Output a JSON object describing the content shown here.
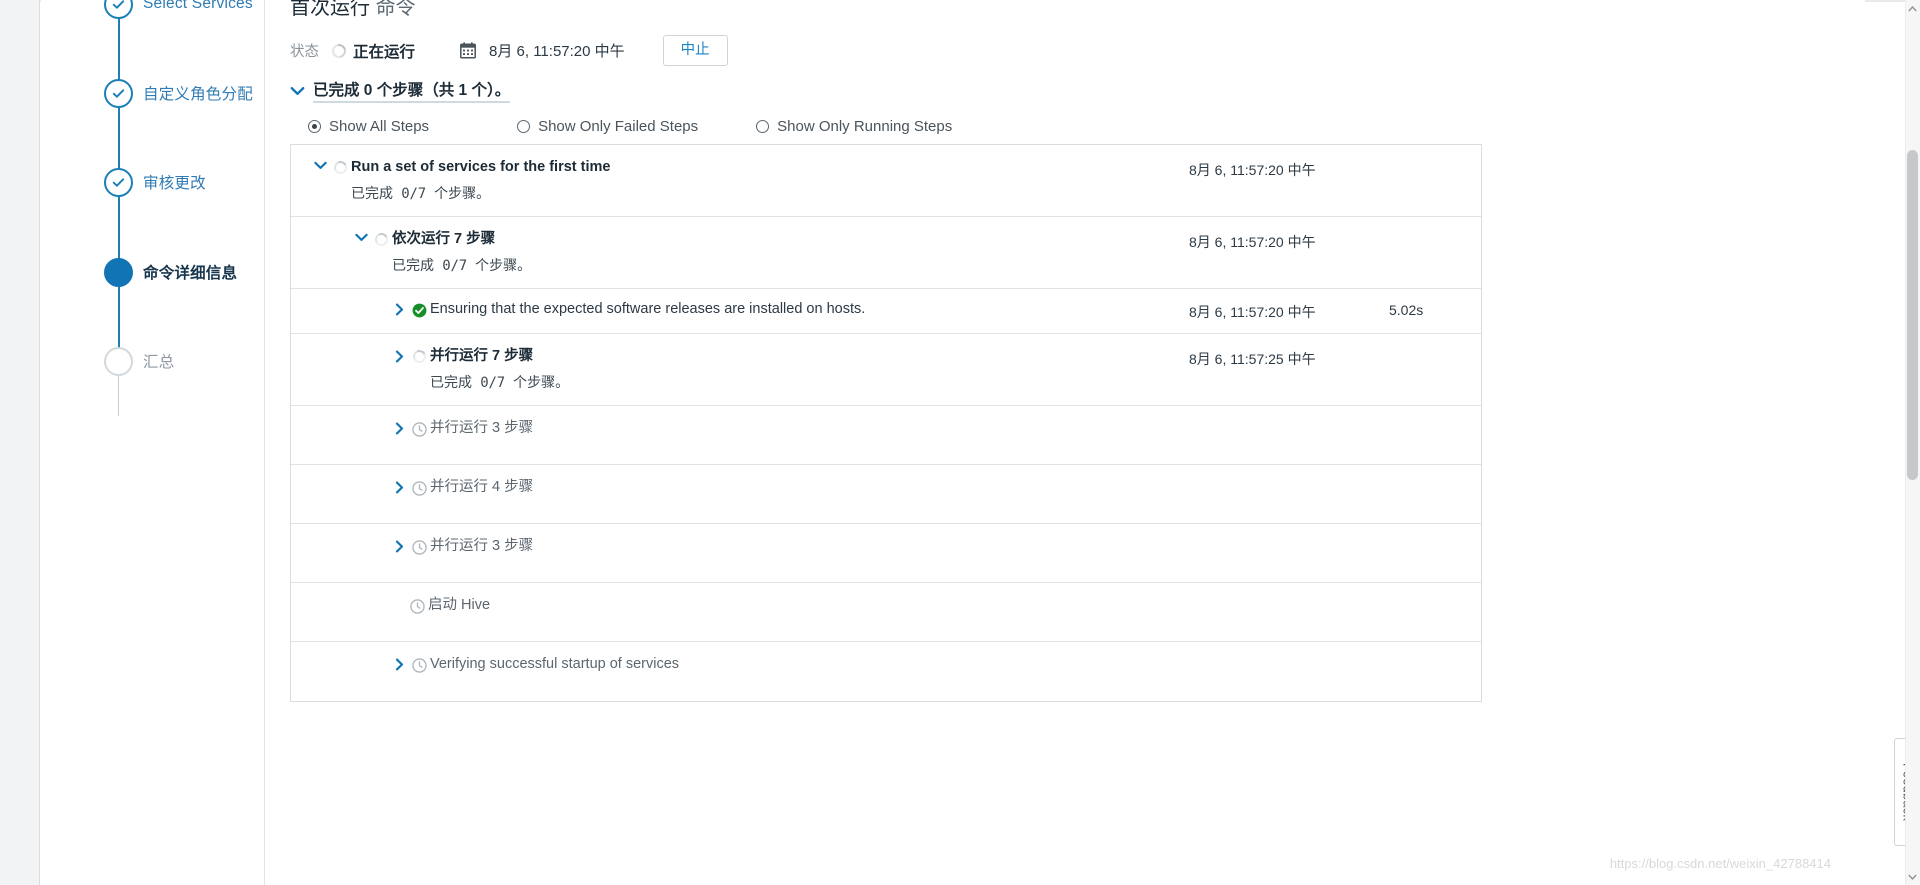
{
  "wizard": {
    "steps": [
      {
        "label": "Select Services",
        "state": "done",
        "icon": "check-circle-icon"
      },
      {
        "label": "自定义角色分配",
        "state": "done",
        "icon": "check-circle-icon"
      },
      {
        "label": "审核更改",
        "state": "done",
        "icon": "check-circle-icon"
      },
      {
        "label": "命令详细信息",
        "state": "current",
        "icon": "filled-circle-icon"
      },
      {
        "label": "汇总",
        "state": "pending",
        "icon": "empty-circle-icon"
      }
    ]
  },
  "header": {
    "title_main": "首次运行",
    "title_suffix": "命令",
    "status_key": "状态",
    "status_value": "正在运行",
    "status_icon": "spinner-icon",
    "calendar_icon": "calendar-icon",
    "started_at": "8月 6, 11:57:20 中午",
    "abort_label": "中止",
    "summary_text": "已完成 0 个步骤（共 1 个）。",
    "summary_chevron": "chevron-down-icon"
  },
  "filters": {
    "options": [
      {
        "label": "Show All Steps",
        "checked": true
      },
      {
        "label": "Show Only Failed Steps",
        "checked": false
      },
      {
        "label": "Show Only Running Steps",
        "checked": false
      }
    ]
  },
  "steps_table": {
    "rows": [
      {
        "title": "Run a set of services for the first time",
        "subtitle_prefix": "已完成",
        "subtitle_count": "0/7",
        "subtitle_suffix": "个步骤。",
        "time": "8月 6, 11:57:20 中午",
        "duration": "",
        "state_icon": "spinner-icon",
        "twisty": "chevron-down-icon"
      },
      {
        "title": "依次运行 7 步骤",
        "subtitle_prefix": "已完成",
        "subtitle_count": "0/7",
        "subtitle_suffix": "个步骤。",
        "time": "8月 6, 11:57:20 中午",
        "duration": "",
        "state_icon": "spinner-icon",
        "twisty": "chevron-down-icon"
      },
      {
        "title": "Ensuring that the expected software releases are installed on hosts.",
        "subtitle_prefix": "",
        "subtitle_count": "",
        "subtitle_suffix": "",
        "time": "8月 6, 11:57:20 中午",
        "duration": "5.02s",
        "state_icon": "check-circle-green-icon",
        "twisty": "chevron-right-icon"
      },
      {
        "title": "并行运行 7 步骤",
        "subtitle_prefix": "已完成",
        "subtitle_count": "0/7",
        "subtitle_suffix": "个步骤。",
        "time": "8月 6, 11:57:25 中午",
        "duration": "",
        "state_icon": "spinner-icon",
        "twisty": "chevron-right-icon"
      },
      {
        "title": "并行运行 3 步骤",
        "subtitle_prefix": "",
        "subtitle_count": "",
        "subtitle_suffix": "",
        "time": "",
        "duration": "",
        "state_icon": "clock-icon",
        "twisty": "chevron-right-icon"
      },
      {
        "title": "并行运行 4 步骤",
        "subtitle_prefix": "",
        "subtitle_count": "",
        "subtitle_suffix": "",
        "time": "",
        "duration": "",
        "state_icon": "clock-icon",
        "twisty": "chevron-right-icon"
      },
      {
        "title": "并行运行 3 步骤",
        "subtitle_prefix": "",
        "subtitle_count": "",
        "subtitle_suffix": "",
        "time": "",
        "duration": "",
        "state_icon": "clock-icon",
        "twisty": "chevron-right-icon"
      },
      {
        "title": "启动 Hive",
        "subtitle_prefix": "",
        "subtitle_count": "",
        "subtitle_suffix": "",
        "time": "",
        "duration": "",
        "state_icon": "clock-icon",
        "twisty": "none"
      },
      {
        "title": "Verifying successful startup of services",
        "subtitle_prefix": "",
        "subtitle_count": "",
        "subtitle_suffix": "",
        "time": "",
        "duration": "",
        "state_icon": "clock-icon",
        "twisty": "chevron-right-icon"
      }
    ]
  },
  "feedback": {
    "label": "Feedback"
  },
  "watermark": {
    "text": "https://blog.csdn.net/weixin_42788414"
  },
  "colors": {
    "accent": "#1174b5",
    "link": "#2f7bb5",
    "success": "#128a2b",
    "muted": "#8a949c",
    "border": "#dcdcdc"
  }
}
